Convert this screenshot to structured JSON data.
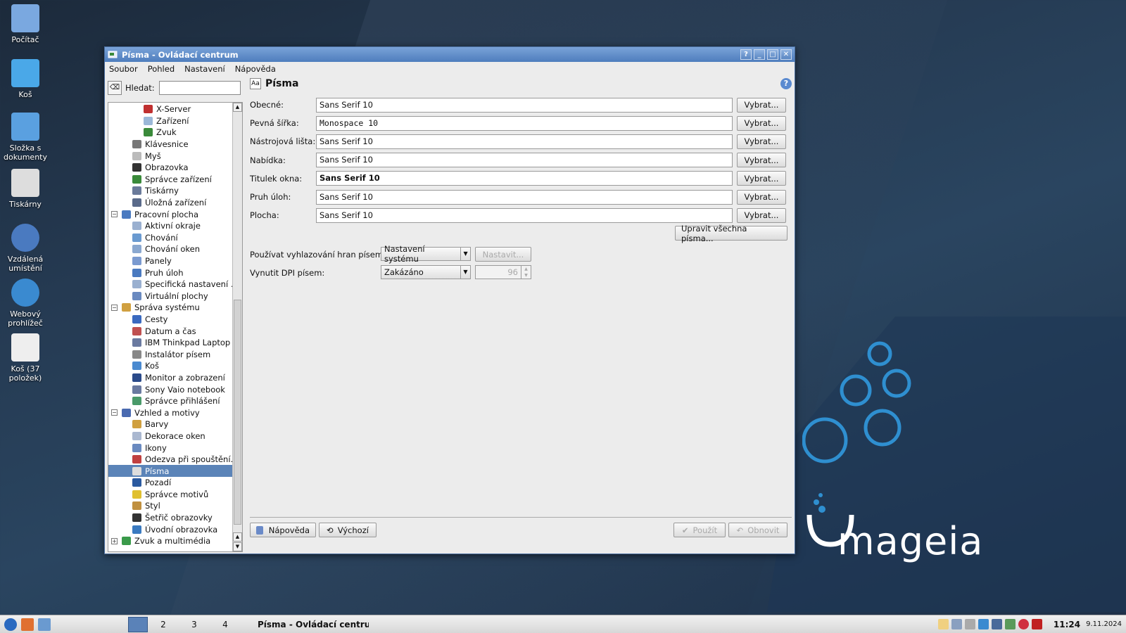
{
  "desktop": {
    "icons": [
      "Počítač",
      "Koš",
      "Složka s dokumenty",
      "Tiskárny",
      "Vzdálená umístění",
      "Webový prohlížeč",
      "Koš (37 položek)"
    ],
    "logo_text": "mageia",
    "colors": {
      "accent": "#2f8fd0",
      "window_title": "#5b84c4"
    }
  },
  "window": {
    "title": "Písma - Ovládací centrum",
    "buttons": [
      "?",
      "_",
      "□",
      "✕"
    ],
    "menu": [
      "Soubor",
      "Pohled",
      "Nastavení",
      "Nápověda"
    ]
  },
  "sidebar": {
    "search_label": "Hledat:",
    "tree": [
      {
        "label": "X-Server",
        "level": 2,
        "color": "#c03030"
      },
      {
        "label": "Zařízení",
        "level": 2,
        "color": "#9bb8d8"
      },
      {
        "label": "Zvuk",
        "level": 2,
        "color": "#3a8a3a"
      },
      {
        "label": "Klávesnice",
        "level": 1,
        "color": "#777777"
      },
      {
        "label": "Myš",
        "level": 1,
        "color": "#bbbbbb"
      },
      {
        "label": "Obrazovka",
        "level": 1,
        "color": "#333333"
      },
      {
        "label": "Správce zařízení",
        "level": 1,
        "color": "#3a8a3a"
      },
      {
        "label": "Tiskárny",
        "level": 1,
        "color": "#6a7a9a"
      },
      {
        "label": "Úložná zařízení",
        "level": 1,
        "color": "#5a6a8a"
      },
      {
        "label": "Pracovní plocha",
        "level": 0,
        "color": "#4a7ac0",
        "expander": "−"
      },
      {
        "label": "Aktivní okraje",
        "level": 1,
        "color": "#9ab0d0"
      },
      {
        "label": "Chování",
        "level": 1,
        "color": "#6a9ad0"
      },
      {
        "label": "Chování oken",
        "level": 1,
        "color": "#8aa8d0"
      },
      {
        "label": "Panely",
        "level": 1,
        "color": "#7a9ad0"
      },
      {
        "label": "Pruh úloh",
        "level": 1,
        "color": "#4a7ac0"
      },
      {
        "label": "Specifická nastavení ...",
        "level": 1,
        "color": "#9ab0d0"
      },
      {
        "label": "Virtuální plochy",
        "level": 1,
        "color": "#6a8ac0"
      },
      {
        "label": "Správa systému",
        "level": 0,
        "color": "#d0a040",
        "expander": "−"
      },
      {
        "label": "Cesty",
        "level": 1,
        "color": "#3a6ac0"
      },
      {
        "label": "Datum a čas",
        "level": 1,
        "color": "#c05050"
      },
      {
        "label": "IBM Thinkpad Laptop",
        "level": 1,
        "color": "#6a7aa0"
      },
      {
        "label": "Instalátor písem",
        "level": 1,
        "color": "#888888"
      },
      {
        "label": "Koš",
        "level": 1,
        "color": "#4a8ad0"
      },
      {
        "label": "Monitor a zobrazení",
        "level": 1,
        "color": "#2a4a8a"
      },
      {
        "label": "Sony Vaio notebook",
        "level": 1,
        "color": "#6a7aa0"
      },
      {
        "label": "Správce přihlášení",
        "level": 1,
        "color": "#4a9a6a"
      },
      {
        "label": "Vzhled a motivy",
        "level": 0,
        "color": "#4a6ab0",
        "expander": "−"
      },
      {
        "label": "Barvy",
        "level": 1,
        "color": "#d0a040"
      },
      {
        "label": "Dekorace oken",
        "level": 1,
        "color": "#aab8d0"
      },
      {
        "label": "Ikony",
        "level": 1,
        "color": "#6a8ac0"
      },
      {
        "label": "Odezva při spouštění...",
        "level": 1,
        "color": "#c04040"
      },
      {
        "label": "Písma",
        "level": 1,
        "color": "#dddddd",
        "selected": true
      },
      {
        "label": "Pozadí",
        "level": 1,
        "color": "#2a5aa0"
      },
      {
        "label": "Správce motivů",
        "level": 1,
        "color": "#e0c030"
      },
      {
        "label": "Styl",
        "level": 1,
        "color": "#c09040"
      },
      {
        "label": "Šetřič obrazovky",
        "level": 1,
        "color": "#333333"
      },
      {
        "label": "Úvodní obrazovka",
        "level": 1,
        "color": "#3a7ac0"
      },
      {
        "label": "Zvuk a multimédia",
        "level": 0,
        "color": "#3a9a4a",
        "expander": "+"
      }
    ]
  },
  "panel": {
    "title": "Písma",
    "header_icon": "Aa",
    "rows": [
      {
        "label": "Obecné:",
        "value": "Sans Serif 10",
        "button": "Vybrat..."
      },
      {
        "label": "Pevná šířka:",
        "value": "Monospace 10",
        "button": "Vybrat...",
        "mono": true
      },
      {
        "label": "Nástrojová lišta:",
        "value": "Sans Serif 10",
        "button": "Vybrat..."
      },
      {
        "label": "Nabídka:",
        "value": "Sans Serif 10",
        "button": "Vybrat..."
      },
      {
        "label": "Titulek okna:",
        "value": "Sans Serif 10",
        "button": "Vybrat...",
        "bold": true
      },
      {
        "label": "Pruh úloh:",
        "value": "Sans Serif 10",
        "button": "Vybrat..."
      },
      {
        "label": "Plocha:",
        "value": "Sans Serif 10",
        "button": "Vybrat..."
      }
    ],
    "adjust_all": "Upravit všechna písma...",
    "antialias_label": "Používat vyhlazování hran písem:",
    "antialias_value": "Nastavení systému",
    "antialias_button": "Nastavit...",
    "dpi_label": "Vynutit DPI písem:",
    "dpi_value": "Zakázáno",
    "dpi_number": "96",
    "help_button": "Nápověda",
    "default_button": "Výchozí",
    "apply_button": "Použít",
    "reset_button": "Obnovit"
  },
  "taskbar": {
    "desktops": [
      "2",
      "3",
      "4"
    ],
    "task": "Písma - Ovládací centrum",
    "clock": "11:24",
    "date": "9.11.2024"
  }
}
